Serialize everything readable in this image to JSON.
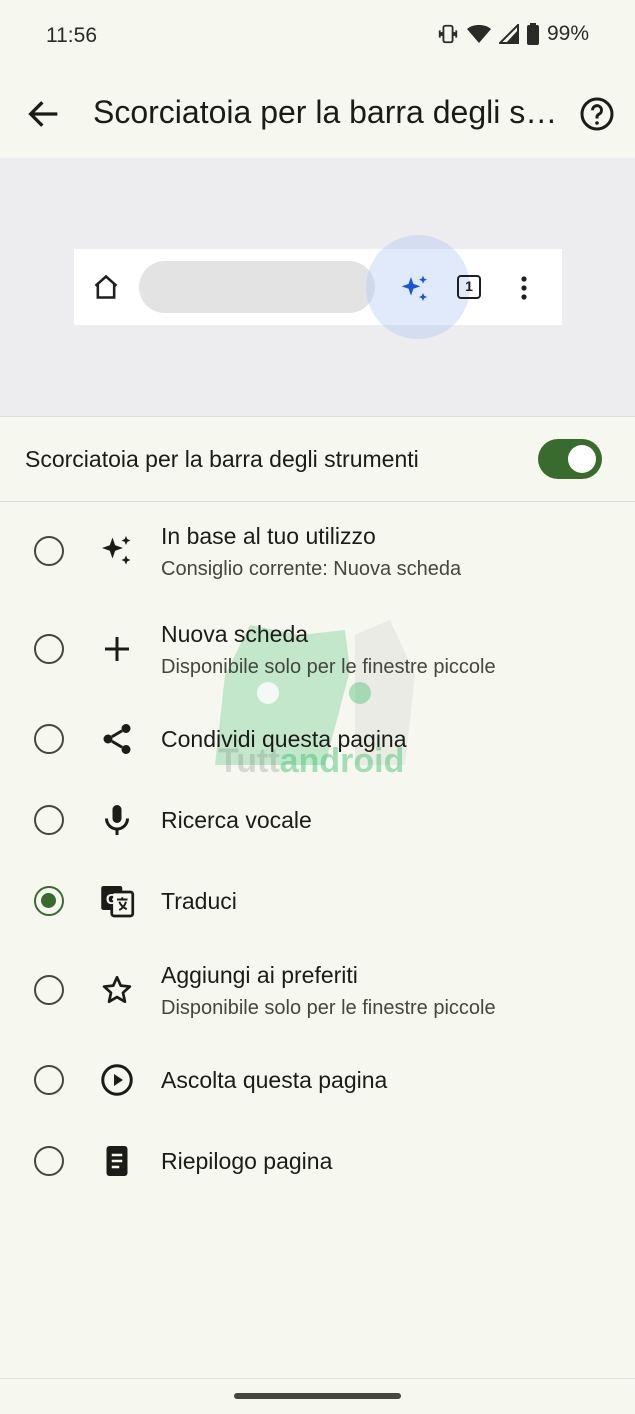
{
  "status_bar": {
    "time": "11:56",
    "battery": "99%"
  },
  "app_bar": {
    "title": "Scorciatoia per la barra degli strumenti",
    "back_icon": "arrow-back-icon",
    "help_icon": "help-circle-icon"
  },
  "preview": {
    "highlighted_shortcut": "sparkle-icon",
    "tab_count": "1"
  },
  "toggle": {
    "label": "Scorciatoia per la barra degli strumenti",
    "enabled": true,
    "accent_color": "#396b2f"
  },
  "options": [
    {
      "title": "In base al tuo utilizzo",
      "subtitle": "Consiglio corrente: Nuova scheda",
      "icon": "sparkle-icon",
      "selected": false
    },
    {
      "title": "Nuova scheda",
      "subtitle": "Disponibile solo per le finestre piccole",
      "icon": "plus-icon",
      "selected": false
    },
    {
      "title": "Condividi questa pagina",
      "subtitle": "",
      "icon": "share-icon",
      "selected": false
    },
    {
      "title": "Ricerca vocale",
      "subtitle": "",
      "icon": "mic-icon",
      "selected": false
    },
    {
      "title": "Traduci",
      "subtitle": "",
      "icon": "translate-icon",
      "selected": true
    },
    {
      "title": "Aggiungi ai preferiti",
      "subtitle": "Disponibile solo per le finestre piccole",
      "icon": "star-outline-icon",
      "selected": false
    },
    {
      "title": "Ascolta questa pagina",
      "subtitle": "",
      "icon": "play-circle-icon",
      "selected": false
    },
    {
      "title": "Riepilogo pagina",
      "subtitle": "",
      "icon": "summary-doc-icon",
      "selected": false
    }
  ],
  "watermark": {
    "part1": "Tutt",
    "part2": "android"
  }
}
